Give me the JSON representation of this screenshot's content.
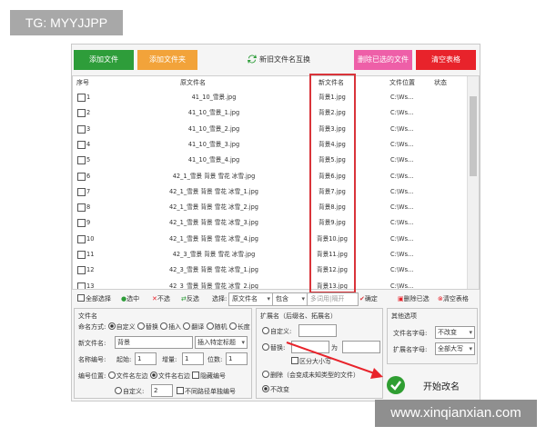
{
  "overlay": {
    "tg": "TG: MYYJJPP",
    "watermark": "www.xinqianxian.com"
  },
  "toolbar_top": {
    "add_file": "添加文件",
    "add_folder": "添加文件夹",
    "rename_toggle": "新旧文件名互换",
    "delete_selected": "删除已选的文件",
    "clear_table": "清空表格",
    "colors": {
      "green": "#2e9d3a",
      "orange": "#f2a33a",
      "pink": "#ee5fa8",
      "red": "#e8232b"
    }
  },
  "table": {
    "headers": {
      "index": "序号",
      "old_name": "原文件名",
      "new_name": "新文件名",
      "location": "文件位置",
      "status": "状态"
    },
    "rows": [
      {
        "index": "1",
        "old": "41_10_雪景.jpg",
        "new": "背景1.jpg",
        "loc": "C:\\Ws..."
      },
      {
        "index": "2",
        "old": "41_10_雪景_1.jpg",
        "new": "背景2.jpg",
        "loc": "C:\\Ws..."
      },
      {
        "index": "3",
        "old": "41_10_雪景_2.jpg",
        "new": "背景3.jpg",
        "loc": "C:\\Ws..."
      },
      {
        "index": "4",
        "old": "41_10_雪景_3.jpg",
        "new": "背景4.jpg",
        "loc": "C:\\Ws..."
      },
      {
        "index": "5",
        "old": "41_10_雪景_4.jpg",
        "new": "背景5.jpg",
        "loc": "C:\\Ws..."
      },
      {
        "index": "6",
        "old": "42_1_雪景 背景 雪花 冰雪.jpg",
        "new": "背景6.jpg",
        "loc": "C:\\Ws..."
      },
      {
        "index": "7",
        "old": "42_1_雪景 背景 雪花 冰雪_1.jpg",
        "new": "背景7.jpg",
        "loc": "C:\\Ws..."
      },
      {
        "index": "8",
        "old": "42_1_雪景 背景 雪花 冰雪_2.jpg",
        "new": "背景8.jpg",
        "loc": "C:\\Ws..."
      },
      {
        "index": "9",
        "old": "42_1_雪景 背景 雪花 冰雪_3.jpg",
        "new": "背景9.jpg",
        "loc": "C:\\Ws..."
      },
      {
        "index": "10",
        "old": "42_1_雪景 背景 雪花 冰雪_4.jpg",
        "new": "背景10.jpg",
        "loc": "C:\\Ws..."
      },
      {
        "index": "11",
        "old": "42_3_雪景 背景 雪花 冰雪.jpg",
        "new": "背景11.jpg",
        "loc": "C:\\Ws..."
      },
      {
        "index": "12",
        "old": "42_3_雪景 背景 雪花 冰雪_1.jpg",
        "new": "背景12.jpg",
        "loc": "C:\\Ws..."
      },
      {
        "index": "13",
        "old": "42_3_雪景 背景 雪花 冰雪_2.jpg",
        "new": "背景13.jpg",
        "loc": "C:\\Ws..."
      }
    ]
  },
  "selbar": {
    "select_all": "全部选择",
    "check": "选中",
    "uncheck": "不选",
    "invert": "反选",
    "choose": "选择:",
    "field": "原文件名",
    "contains": "包含",
    "multi_placeholder": "多词用|隔开",
    "confirm": "确定",
    "delete_selected": "删除已选",
    "clear_table": "清空表格"
  },
  "filename_panel": {
    "title": "文件名",
    "naming_mode": "命名方式:",
    "mode_custom": "自定义",
    "mode_replace": "替换",
    "mode_insert": "插入",
    "mode_translate": "翻译",
    "mode_random": "随机",
    "mode_length": "长度",
    "new_name_label": "新文件名:",
    "new_name_value": "背景",
    "insert_tag": "插入特定标题",
    "numbering": "名称编号:",
    "start_label": "起始:",
    "start_value": "1",
    "step_label": "增量:",
    "step_value": "1",
    "digits_label": "位数:",
    "digits_value": "1",
    "position_label": "编号位置:",
    "pos_left": "文件名左边",
    "pos_right": "文件名右边",
    "hide_number": "隐藏编号",
    "custom_label": "自定义:",
    "custom_value": "2",
    "no_repeat": "不同路径单独编号"
  },
  "ext_panel": {
    "title": "扩展名（后缀名、拓展名）",
    "custom": "自定义:",
    "replace": "替换:",
    "to": "为",
    "case_sensitive": "区分大小写",
    "delete": "删除（会变成未知类型的文件）",
    "unchanged": "不改变"
  },
  "other_panel": {
    "title": "其他选项",
    "name_case_label": "文件名字母:",
    "name_case_value": "不改变",
    "ext_case_label": "扩展名字母:",
    "ext_case_value": "全部大写"
  },
  "start_button": {
    "label": "开始改名"
  }
}
